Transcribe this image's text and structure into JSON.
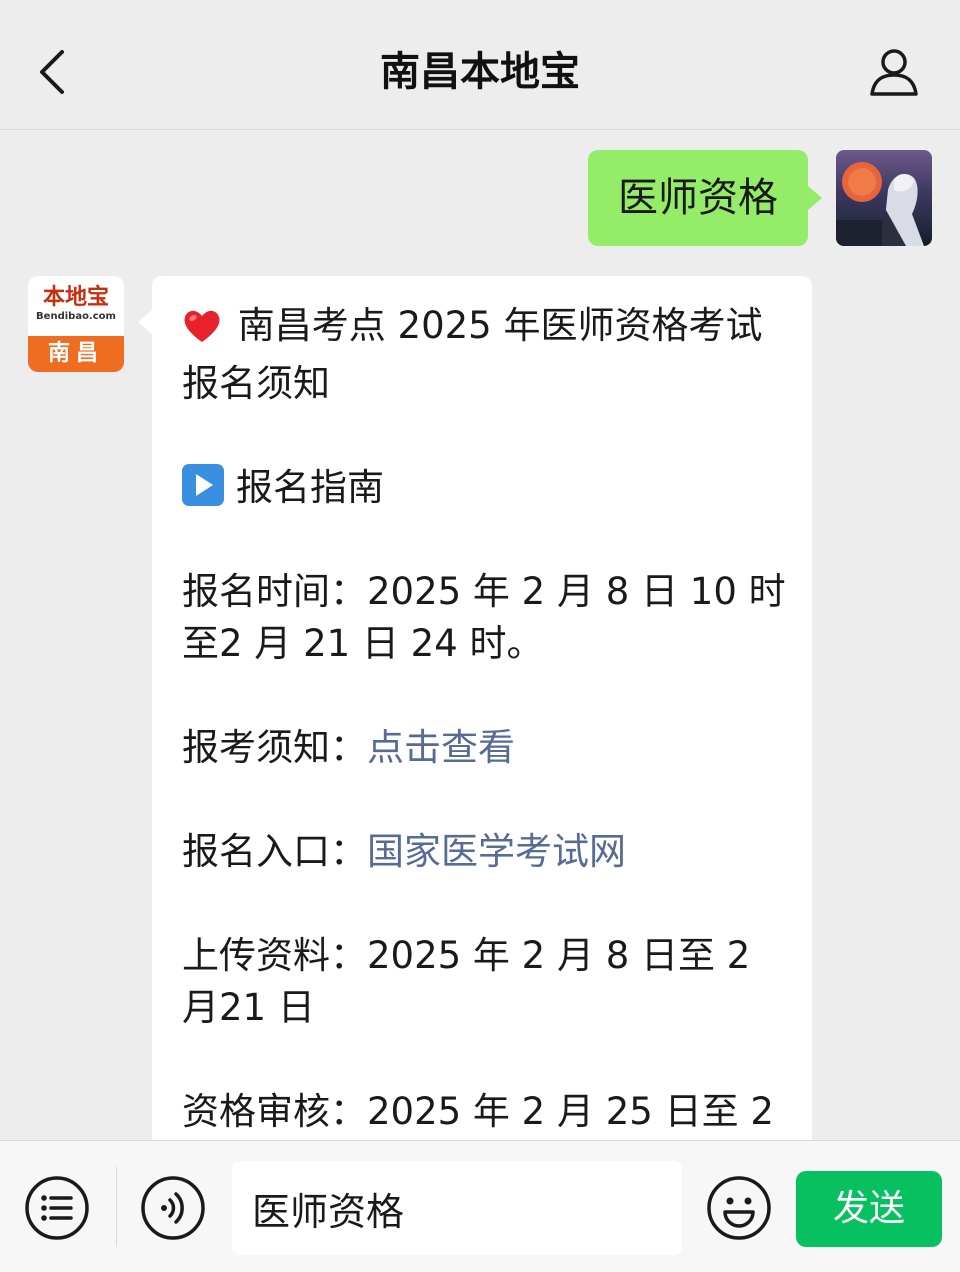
{
  "header": {
    "title": "南昌本地宝"
  },
  "messages": {
    "outgoing": {
      "text": "医师资格"
    },
    "incoming": {
      "bot_avatar": {
        "logo_cn": "本地宝",
        "logo_en": "Bendibao.com",
        "city": "南昌"
      },
      "heading": "南昌考点 2025 年医师资格考试报名须知",
      "guide_title": "报名指南",
      "reg_time_label": "报名时间：",
      "reg_time_value": "2025 年 2 月 8 日 10 时至2 月 21 日 24 时。",
      "notice_label": "报考须知：",
      "notice_link": "点击查看",
      "entry_label": "报名入口：",
      "entry_link": "国家医学考试网",
      "upload_label": "上传资料：",
      "upload_value": "2025 年 2 月 8 日至 2 月21 日",
      "review_label": "资格审核：",
      "review_value": "2025 年 2 月 25 日至 2"
    }
  },
  "input_bar": {
    "input_value": "医师资格",
    "send_label": "发送"
  },
  "colors": {
    "background": "#ededed",
    "outgoing_bubble": "#95ec69",
    "link": "#576b95",
    "send_button": "#07c160",
    "logo_orange": "#ef6d21"
  },
  "icons": {
    "back": "chevron-left-icon",
    "profile": "person-icon",
    "heart": "red-heart-emoji",
    "play": "play-button-emoji",
    "menu": "list-icon",
    "voice": "voice-icon",
    "emoji": "smiley-icon"
  }
}
